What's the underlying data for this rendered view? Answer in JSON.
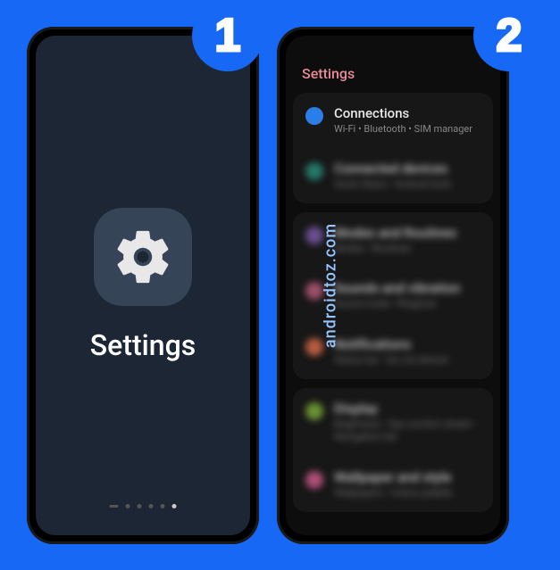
{
  "badges": {
    "step1": "1",
    "step2": "2"
  },
  "watermark": "androidtoz.com",
  "phone1": {
    "app_label": "Settings"
  },
  "phone2": {
    "header": "Settings",
    "items": [
      {
        "title": "Connections",
        "subtitle": "Wi-Fi • Bluetooth • SIM manager",
        "icon_color": "#2b7de8",
        "focused": true
      },
      {
        "title": "Connected devices",
        "subtitle": "Quick Share • Android Auto",
        "icon_color": "#2a8a7a",
        "focused": false
      },
      {
        "title": "Modes and Routines",
        "subtitle": "Modes • Routines",
        "icon_color": "#7a5aa8",
        "focused": false
      },
      {
        "title": "Sounds and vibration",
        "subtitle": "Sound mode • Ringtone",
        "icon_color": "#b55a7a",
        "focused": false
      },
      {
        "title": "Notifications",
        "subtitle": "Status bar • Do not disturb",
        "icon_color": "#d66a4a",
        "focused": false
      },
      {
        "title": "Display",
        "subtitle": "Brightness • Eye comfort shield • Navigation bar",
        "icon_color": "#7aa83a",
        "focused": false
      },
      {
        "title": "Wallpaper and style",
        "subtitle": "Wallpapers • Colour palette",
        "icon_color": "#c85a8a",
        "focused": false
      }
    ]
  }
}
